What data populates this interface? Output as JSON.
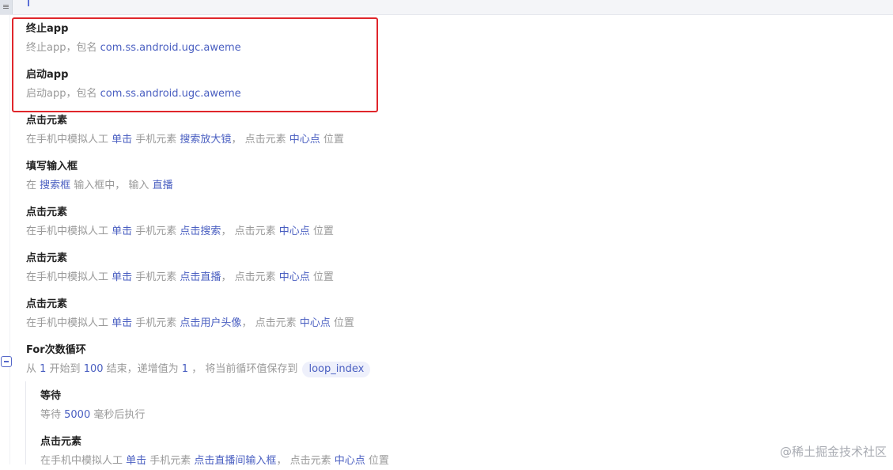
{
  "toolbar": {
    "corner_label": "≡"
  },
  "steps": [
    {
      "title": "终止app",
      "desc": {
        "prefix": "终止app，包名 ",
        "package": "com.ss.android.ugc.aweme"
      }
    },
    {
      "title": "启动app",
      "desc": {
        "prefix": "启动app，包名 ",
        "package": "com.ss.android.ugc.aweme"
      }
    },
    {
      "title": "点击元素",
      "desc": {
        "t1": "在手机中模拟人工 ",
        "action": "单击",
        "t2": " 手机元素 ",
        "element": "搜索放大镜",
        "t3": "， 点击元素 ",
        "position": "中心点",
        "t4": " 位置"
      }
    },
    {
      "title": "填写输入框",
      "desc": {
        "t1": "在 ",
        "field": "搜索框",
        "t2": " 输入框中， 输入 ",
        "value": "直播"
      }
    },
    {
      "title": "点击元素",
      "desc": {
        "t1": "在手机中模拟人工 ",
        "action": "单击",
        "t2": " 手机元素 ",
        "element": "点击搜索",
        "t3": "， 点击元素 ",
        "position": "中心点",
        "t4": " 位置"
      }
    },
    {
      "title": "点击元素",
      "desc": {
        "t1": "在手机中模拟人工 ",
        "action": "单击",
        "t2": " 手机元素 ",
        "element": "点击直播",
        "t3": "， 点击元素 ",
        "position": "中心点",
        "t4": " 位置"
      }
    },
    {
      "title": "点击元素",
      "desc": {
        "t1": "在手机中模拟人工 ",
        "action": "单击",
        "t2": " 手机元素 ",
        "element": "点击用户头像",
        "t3": "， 点击元素 ",
        "position": "中心点",
        "t4": " 位置"
      }
    },
    {
      "title": "For次数循环",
      "desc": {
        "t1": "从 ",
        "start": "1",
        "t2": " 开始到 ",
        "end": "100",
        "t3": " 结束，递增值为 ",
        "step": "1",
        "t4": " ， 将当前循环值保存到 ",
        "var": "loop_index"
      }
    },
    {
      "title": "等待",
      "desc": {
        "t1": "等待 ",
        "ms": "5000",
        "t2": " 毫秒后执行"
      }
    },
    {
      "title": "点击元素",
      "desc": {
        "t1": "在手机中模拟人工 ",
        "action": "单击",
        "t2": " 手机元素 ",
        "element": "点击直播间输入框",
        "t3": "， 点击元素 ",
        "position": "中心点",
        "t4": " 位置"
      }
    }
  ],
  "watermark": "@稀土掘金技术社区",
  "colors": {
    "accent": "#4a5fc1",
    "highlight_border": "#e0262b"
  }
}
